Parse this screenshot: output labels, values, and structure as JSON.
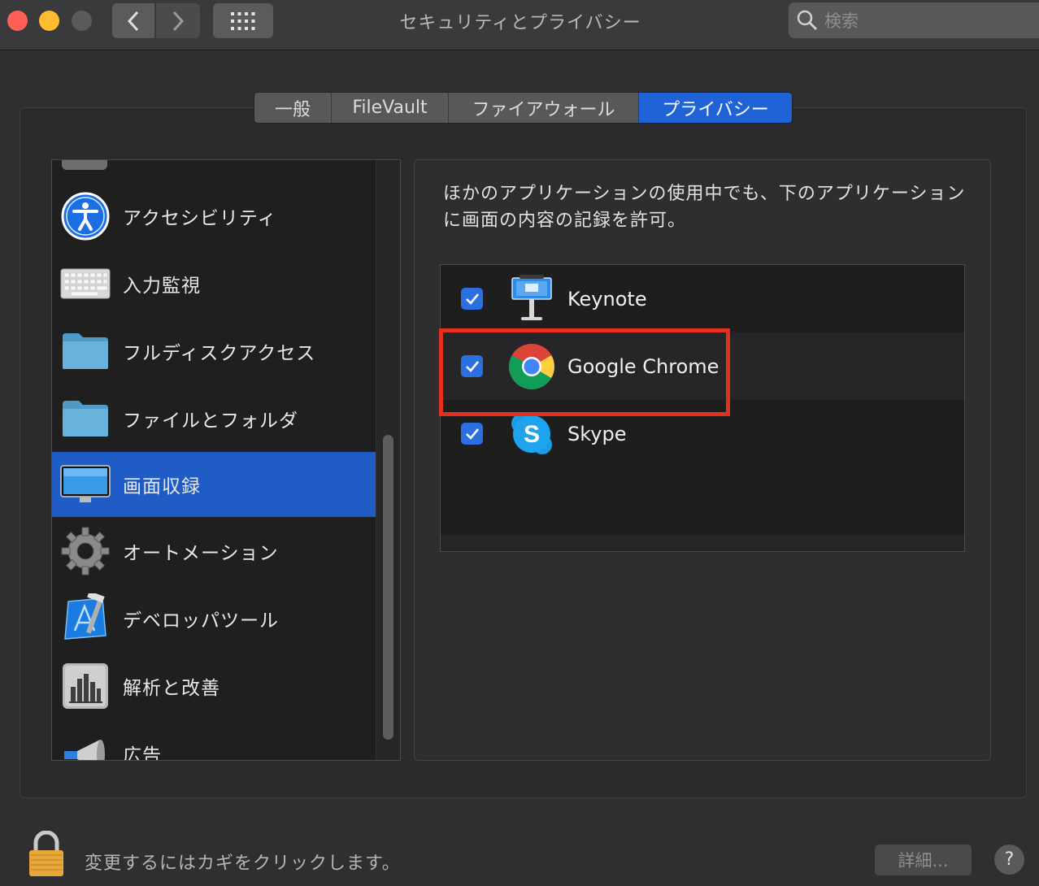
{
  "window": {
    "title": "セキュリティとプライバシー",
    "search_placeholder": "検索",
    "icons": [
      "close-button",
      "minimize-button",
      "zoom-button",
      "back-chevron-icon",
      "forward-chevron-icon",
      "grid-icon",
      "search-icon"
    ]
  },
  "tabs": [
    {
      "label": "一般",
      "active": false
    },
    {
      "label": "FileVault",
      "active": false
    },
    {
      "label": "ファイアウォール",
      "active": false
    },
    {
      "label": "プライバシー",
      "active": true
    }
  ],
  "sidebar": {
    "items": [
      {
        "label": "アクセシビリティ",
        "icon": "accessibility-icon",
        "selected": false
      },
      {
        "label": "入力監視",
        "icon": "keyboard-icon",
        "selected": false
      },
      {
        "label": "フルディスクアクセス",
        "icon": "folder-icon",
        "selected": false
      },
      {
        "label": "ファイルとフォルダ",
        "icon": "folder-icon",
        "selected": false
      },
      {
        "label": "画面収録",
        "icon": "display-icon",
        "selected": true
      },
      {
        "label": "オートメーション",
        "icon": "gear-icon",
        "selected": false
      },
      {
        "label": "デベロッパツール",
        "icon": "xcode-icon",
        "selected": false
      },
      {
        "label": "解析と改善",
        "icon": "bar-chart-icon",
        "selected": false
      },
      {
        "label": "広告",
        "icon": "megaphone-icon",
        "selected": false
      }
    ]
  },
  "main": {
    "description": "ほかのアプリケーションの使用中でも、下のアプリケーションに画面の内容の記録を許可。",
    "apps": [
      {
        "name": "Keynote",
        "checked": true,
        "icon": "keynote-icon"
      },
      {
        "name": "Google Chrome",
        "checked": true,
        "icon": "chrome-icon",
        "highlighted": true
      },
      {
        "name": "Skype",
        "checked": true,
        "icon": "skype-icon"
      }
    ]
  },
  "footer": {
    "lock_text": "変更するにはカギをクリックします。",
    "advanced_label": "詳細...",
    "help_label": "?"
  },
  "colors": {
    "accent": "#1f63d6",
    "highlight_box": "#e5301f"
  }
}
